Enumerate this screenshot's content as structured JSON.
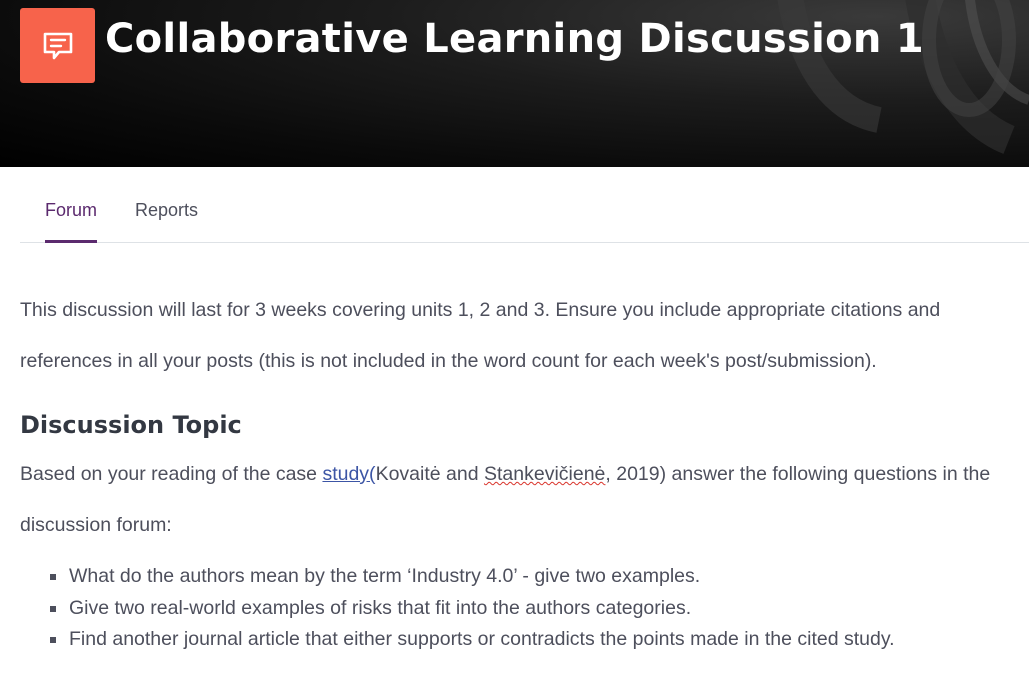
{
  "header": {
    "title": "Collaborative Learning Discussion 1",
    "icon": "forum-chat-icon",
    "icon_bg_color": "#f7634b"
  },
  "tabs": [
    {
      "label": "Forum",
      "active": true
    },
    {
      "label": "Reports",
      "active": false
    }
  ],
  "accent_color": "#5b2a6e",
  "main": {
    "intro": "This discussion will last for 3 weeks covering units 1, 2 and 3. Ensure you include appropriate citations and references in all your posts (this is not included in the word count for each week's post/submission).",
    "heading": "Discussion Topic",
    "topic": {
      "prefix": "Based on your reading of the case ",
      "link_text": "study(",
      "author_a": "Kovaitė and ",
      "author_b": "Stankevičienė",
      "suffix": ", 2019) answer the following questions in the discussion forum:"
    },
    "questions": [
      "What do the authors mean by the term ‘Industry 4.0’ - give two examples.",
      "Give two real-world examples of risks that fit into the authors categories.",
      "Find another journal article that either supports or contradicts the points made in the cited study."
    ]
  }
}
